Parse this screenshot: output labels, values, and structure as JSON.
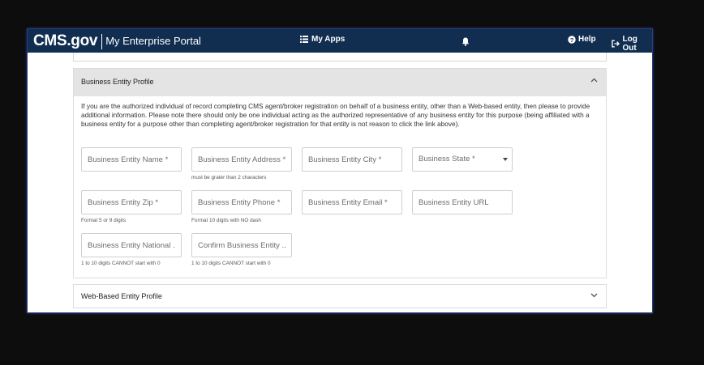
{
  "header": {
    "logo": "CMS.gov",
    "portal_name": "My Enterprise Portal",
    "my_apps": "My Apps",
    "help": "Help",
    "logout": "Log Out"
  },
  "business_entity_profile": {
    "title": "Business Entity Profile",
    "intro": "If you are the authorized individual of record completing CMS agent/broker registration on behalf of a business entity, other than a Web-based entity, then please to provide additional information. Please note there should only be one individual acting as the authorized representative of any business entity for this purpose (being affiliated with a business entity for a purpose other than completing agent/broker registration for that entity is not reason to click the link above).",
    "fields": {
      "name": {
        "placeholder": "Business Entity Name *"
      },
      "address": {
        "placeholder": "Business Entity Address *",
        "hint": "must be grater than 2 characters"
      },
      "city": {
        "placeholder": "Business Entity City *"
      },
      "state": {
        "placeholder": "Business State *"
      },
      "zip": {
        "placeholder": "Business Entity Zip *",
        "hint": "Format 5 or 9 digits"
      },
      "phone": {
        "placeholder": "Business Entity Phone *",
        "hint": "Format 10 digits with NO dash"
      },
      "email": {
        "placeholder": "Business Entity Email *"
      },
      "url": {
        "placeholder": "Business Entity URL"
      },
      "national": {
        "placeholder": "Business Entity National ...",
        "hint": "1 to 10 digits CANNOT start with 0"
      },
      "confirm": {
        "placeholder": "Confirm Business Entity ...",
        "hint": "1 to 10 digits CANNOT start with 0"
      }
    }
  },
  "web_based_entity_profile": {
    "title": "Web-Based Entity Profile"
  },
  "colors": {
    "header_bg": "#112e51",
    "panel_header_bg": "#e4e4e4",
    "frame_border": "#2a3b82"
  }
}
